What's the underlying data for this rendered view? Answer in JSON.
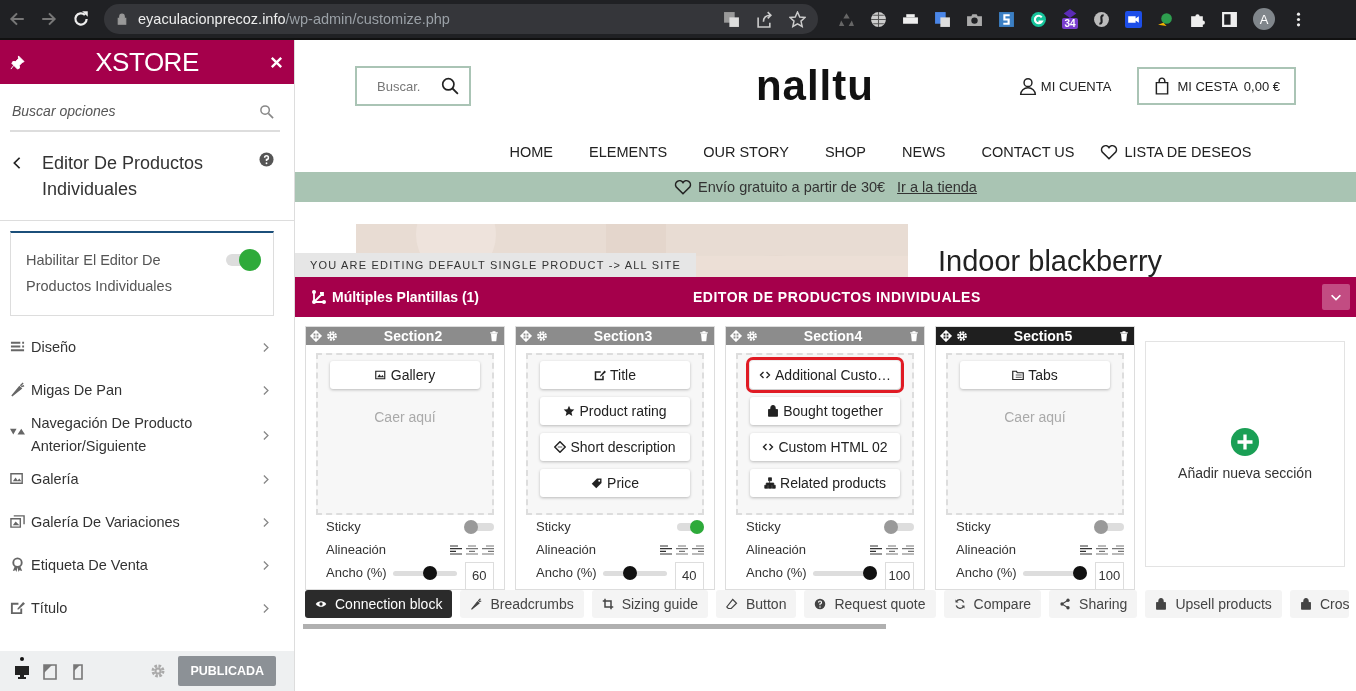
{
  "browser": {
    "url_host": "eyaculacionprecoz.info",
    "url_path": "/wp-admin/customize.php",
    "extension_badge": "34",
    "profile_initial": "A"
  },
  "sidebar": {
    "logo": "XSTORE",
    "search": {
      "placeholder": "Buscar opciones"
    },
    "panel_title": "Editor De Productos Individuales",
    "setting": {
      "label": "Habilitar El Editor De Productos Individuales",
      "on": true
    },
    "items": [
      {
        "label": "Diseño"
      },
      {
        "label": "Migas De Pan"
      },
      {
        "label": "Navegación De Producto Anterior/Siguiente"
      },
      {
        "label": "Galería"
      },
      {
        "label": "Galería De Variaciones"
      },
      {
        "label": "Etiqueta De Venta"
      },
      {
        "label": "Título"
      }
    ],
    "devices": [
      {
        "selected": true
      },
      {
        "selected": false
      },
      {
        "selected": false
      }
    ],
    "publish_button": "PUBLICADA"
  },
  "site": {
    "search": {
      "placeholder": "Buscar."
    },
    "logo": "nalltu",
    "account": "MI CUENTA",
    "cart": {
      "label": "MI CESTA",
      "total": "0,00 €"
    },
    "nav": [
      "HOME",
      "ELEMENTS",
      "OUR STORY",
      "SHOP",
      "NEWS",
      "CONTACT US"
    ],
    "wishlist": "LISTA DE DESEOS",
    "promo": {
      "text": "Envío gratuito a partir de 30€",
      "link": "Ir a la tienda"
    },
    "product_title": "Indoor blackberry"
  },
  "builder": {
    "notice": "YOU ARE EDITING DEFAULT SINGLE PRODUCT -> ALL SITE",
    "templates": "Múltiples Plantillas (1)",
    "title": "EDITOR DE PRODUCTOS INDIVIDUALES",
    "sections": [
      {
        "title": "Section2",
        "selected": false,
        "blocks": [
          {
            "label": "Gallery",
            "highlighted": false
          }
        ],
        "drop_hint": "Caer aquí",
        "sticky_label": "Sticky",
        "sticky": false,
        "align_label": "Alineación",
        "width_label": "Ancho (%)",
        "level": 0.6,
        "width_value": "60"
      },
      {
        "title": "Section3",
        "selected": false,
        "blocks": [
          {
            "label": "Title",
            "highlighted": false
          },
          {
            "label": "Product rating",
            "highlighted": false
          },
          {
            "label": "Short description",
            "highlighted": false
          },
          {
            "label": "Price",
            "highlighted": false
          }
        ],
        "sticky_label": "Sticky",
        "sticky": true,
        "align_label": "Alineación",
        "width_label": "Ancho (%)",
        "level": 0.4,
        "width_value": "40"
      },
      {
        "title": "Section4",
        "selected": false,
        "blocks": [
          {
            "label": "Additional Custo…",
            "highlighted": true
          },
          {
            "label": "Bought together",
            "highlighted": false
          },
          {
            "label": "Custom HTML 02",
            "highlighted": false
          },
          {
            "label": "Related products",
            "highlighted": false
          }
        ],
        "sticky_label": "Sticky",
        "sticky": false,
        "align_label": "Alineación",
        "width_label": "Ancho (%)",
        "level": 1,
        "width_value": "100"
      },
      {
        "title": "Section5",
        "selected": true,
        "blocks": [
          {
            "label": "Tabs",
            "highlighted": false
          }
        ],
        "drop_hint": "Caer aquí",
        "sticky_label": "Sticky",
        "sticky": false,
        "align_label": "Alineación",
        "width_label": "Ancho (%)",
        "level": 1,
        "width_value": "100"
      }
    ],
    "add_section": "Añadir nueva sección",
    "elements": [
      {
        "label": "Connection block",
        "selected": true
      },
      {
        "label": "Breadcrumbs",
        "selected": false
      },
      {
        "label": "Sizing guide",
        "selected": false
      },
      {
        "label": "Button",
        "selected": false
      },
      {
        "label": "Request quote",
        "selected": false
      },
      {
        "label": "Compare",
        "selected": false
      },
      {
        "label": "Sharing",
        "selected": false
      },
      {
        "label": "Upsell products",
        "selected": false
      },
      {
        "label": "Cros",
        "selected": false
      }
    ]
  }
}
